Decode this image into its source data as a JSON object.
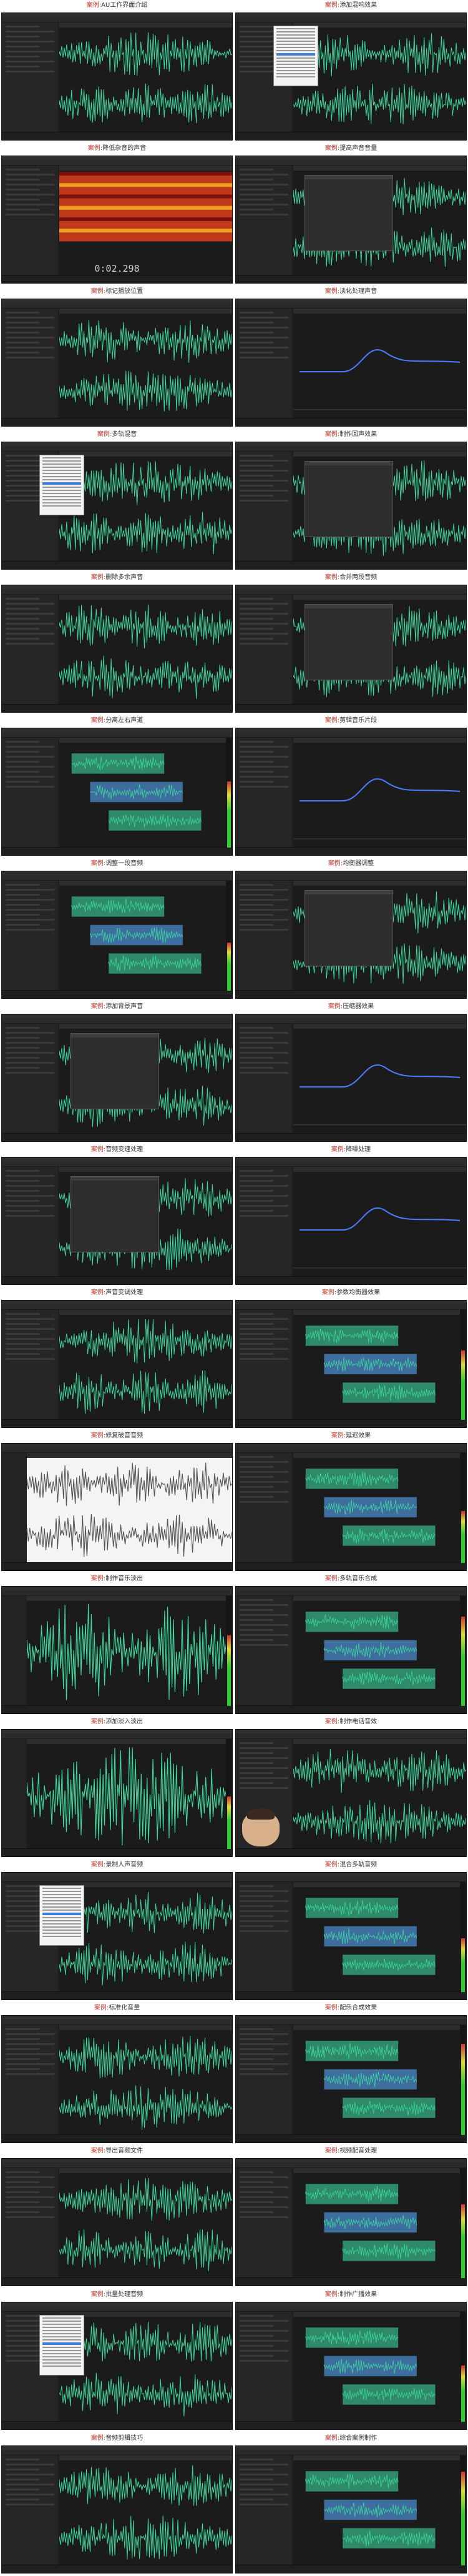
{
  "captions": [
    {
      "label": "案例:",
      "title": "AU工作界面介绍"
    },
    {
      "label": "案例:",
      "title": "添加混响效果"
    },
    {
      "label": "案例:",
      "title": "降低杂音的声音"
    },
    {
      "label": "案例:",
      "title": "提高声音音量"
    },
    {
      "label": "案例:",
      "title": "标记播放位置"
    },
    {
      "label": "案例:",
      "title": "淡化处理声音"
    },
    {
      "label": "案例:",
      "title": "多轨混音"
    },
    {
      "label": "案例:",
      "title": "制作回声效果"
    },
    {
      "label": "案例:",
      "title": "删除多余声音"
    },
    {
      "label": "案例:",
      "title": "合并两段音频"
    },
    {
      "label": "案例:",
      "title": "分离左右声道"
    },
    {
      "label": "案例:",
      "title": "剪辑音乐片段"
    },
    {
      "label": "案例:",
      "title": "调整一段音频"
    },
    {
      "label": "案例:",
      "title": "均衡器调整"
    },
    {
      "label": "案例:",
      "title": "添加背景声音"
    },
    {
      "label": "案例:",
      "title": "压缩器效果"
    },
    {
      "label": "案例:",
      "title": "音频变速处理"
    },
    {
      "label": "案例:",
      "title": "降噪处理"
    },
    {
      "label": "案例:",
      "title": "声音变调处理"
    },
    {
      "label": "案例:",
      "title": "参数均衡器效果"
    },
    {
      "label": "案例:",
      "title": "修复破音音频"
    },
    {
      "label": "案例:",
      "title": "延迟效果"
    },
    {
      "label": "案例:",
      "title": "制作音乐淡出"
    },
    {
      "label": "案例:",
      "title": "多轨音乐合成"
    },
    {
      "label": "案例:",
      "title": "添加淡入淡出"
    },
    {
      "label": "案例:",
      "title": "制作电话音效"
    },
    {
      "label": "案例:",
      "title": "录制人声音频"
    },
    {
      "label": "案例:",
      "title": "混合多轨音频"
    },
    {
      "label": "案例:",
      "title": "标准化音量"
    },
    {
      "label": "案例:",
      "title": "配乐合成效果"
    },
    {
      "label": "案例:",
      "title": "导出音频文件"
    },
    {
      "label": "案例:",
      "title": "视频配音处理"
    },
    {
      "label": "案例:",
      "title": "批量处理音频"
    },
    {
      "label": "案例:",
      "title": "制作广播效果"
    },
    {
      "label": "案例:",
      "title": "音频剪辑技巧"
    },
    {
      "label": "案例:",
      "title": "综合案例制作"
    }
  ],
  "timecode": "0:02.298",
  "colors": {
    "wave": "#3fd8a0",
    "wave_dark": "#1e7d5c",
    "bg": "#232323"
  }
}
